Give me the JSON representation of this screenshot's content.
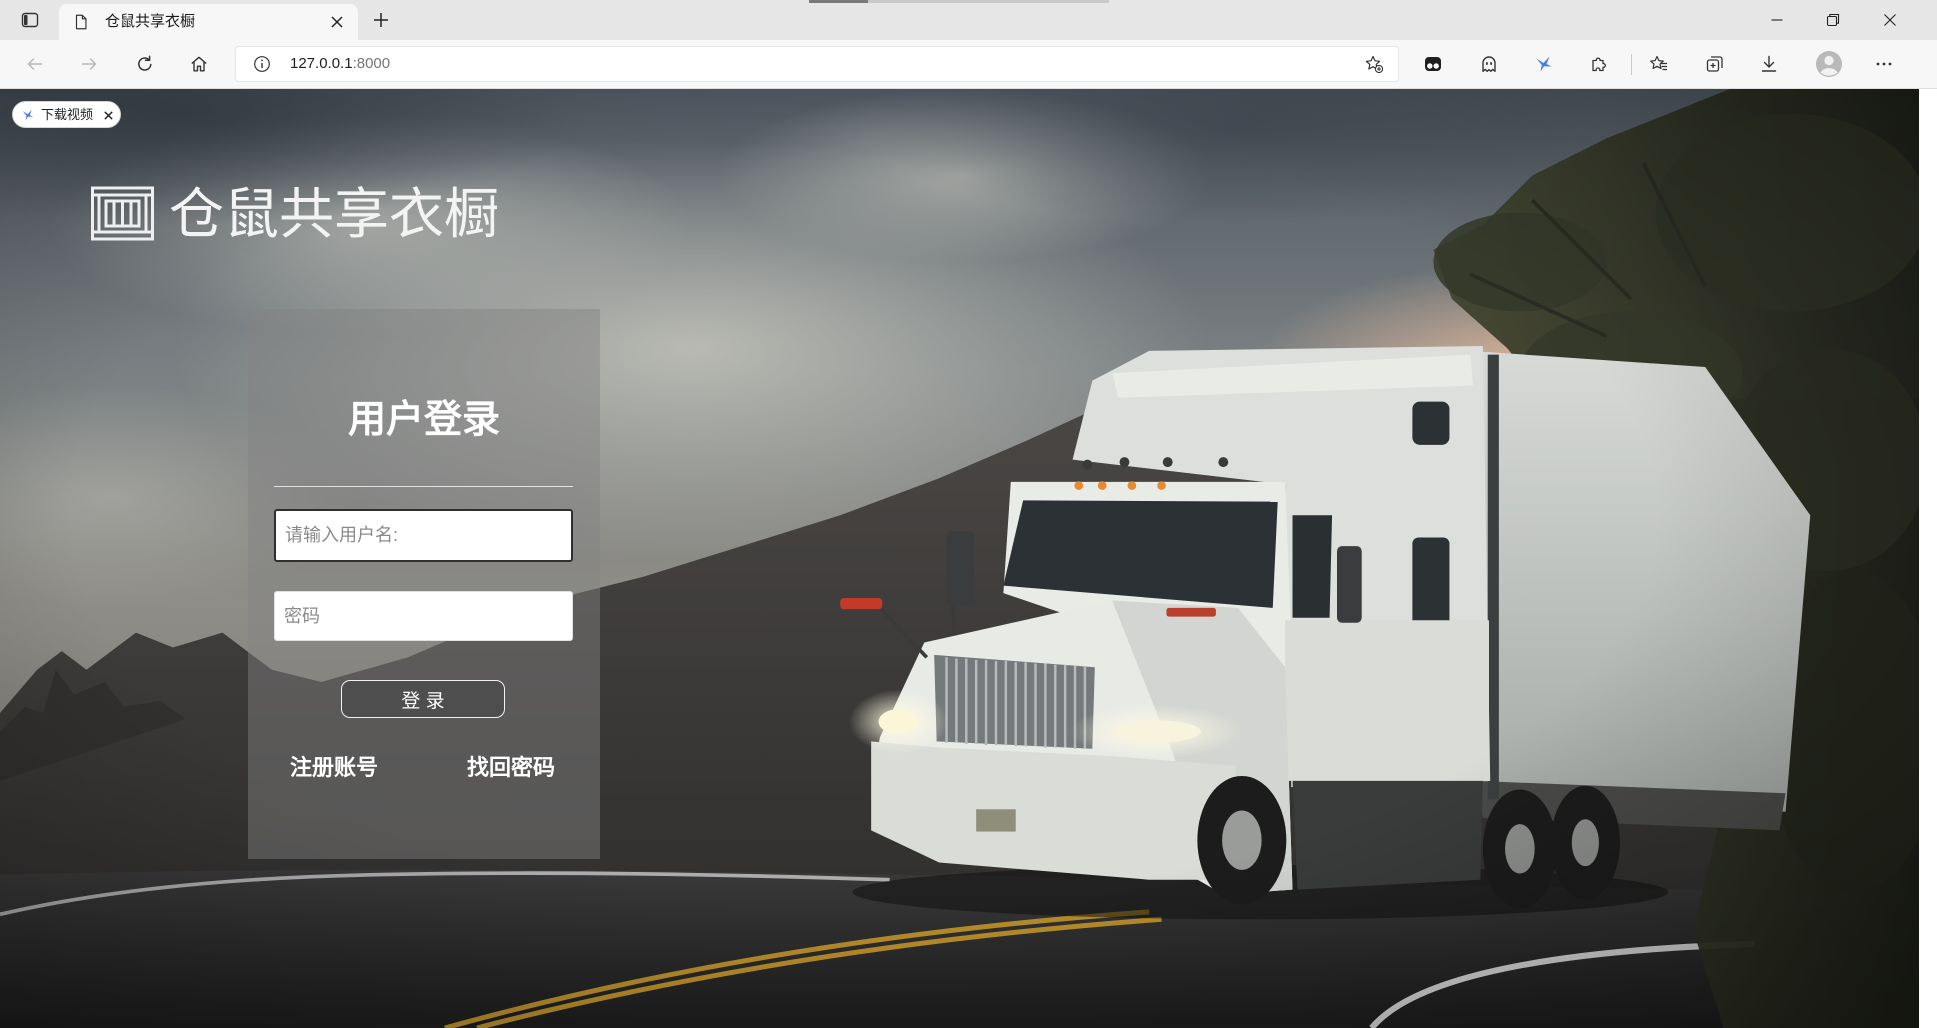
{
  "browser": {
    "tab": {
      "title": "仓鼠共享衣橱",
      "icon": "document-icon",
      "close_icon": "close-icon"
    },
    "new_tab_icon": "plus-icon",
    "sidebar_icon": "tab-actions-icon",
    "window_controls": [
      "minimize-icon",
      "restore-icon",
      "close-icon"
    ],
    "navigation": {
      "back_icon": "back-arrow-icon",
      "forward_icon": "forward-arrow-icon",
      "reload_icon": "reload-icon",
      "home_icon": "home-icon"
    },
    "address": {
      "info_icon": "info-icon",
      "host": "127.0.0.1",
      "port": ":8000",
      "favorite_icon": "add-favorite-icon"
    },
    "extensions": [
      "tampermonkey-icon",
      "ghost-icon",
      "blue-bird-icon",
      "puzzle-icon"
    ],
    "toolbar_right": [
      "favorites-icon",
      "collections-icon",
      "download-icon",
      "avatar-icon",
      "more-icon"
    ]
  },
  "page": {
    "download_badge": {
      "icon": "blue-bird-icon",
      "label": "下载视频",
      "close_icon": "close-icon"
    },
    "brand": {
      "logo_icon": "wardrobe-icon",
      "name": "仓鼠共享衣橱"
    },
    "login": {
      "title": "用户登录",
      "username": {
        "placeholder": "请输入用户名:",
        "value": ""
      },
      "password": {
        "placeholder": "密码",
        "value": ""
      },
      "submit_label": "登 录",
      "register_link": "注册账号",
      "forgot_link": "找回密码"
    }
  },
  "colors": {
    "tab_strip": "#e6e6e6",
    "toolbar": "#f7f7f7",
    "panel_text": "#ffffff",
    "input_focus_border": "#2f2f2f",
    "extension_blue": "#4a7be8"
  }
}
